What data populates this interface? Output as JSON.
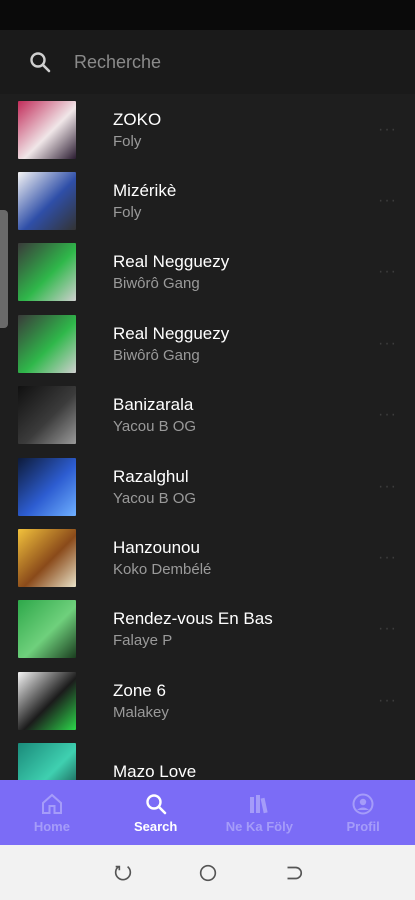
{
  "search": {
    "placeholder": "Recherche",
    "icon": "search-icon"
  },
  "tracks": [
    {
      "title": "ZOKO",
      "artist": "Foly",
      "more": "···",
      "art_colors": [
        "#c22c5a",
        "#f0e6e8",
        "#2a1b30"
      ]
    },
    {
      "title": "Mizérikè",
      "artist": "Foly",
      "more": "···",
      "art_colors": [
        "#f4f4f4",
        "#2f4fa8",
        "#333333"
      ]
    },
    {
      "title": "Real Negguezy",
      "artist": "Biwôrô Gang",
      "more": "···",
      "art_colors": [
        "#3a3a3a",
        "#2fb84a",
        "#cfcfcf"
      ]
    },
    {
      "title": "Real Negguezy",
      "artist": "Biwôrô Gang",
      "more": "···",
      "art_colors": [
        "#3a3a3a",
        "#2fb84a",
        "#cfcfcf"
      ]
    },
    {
      "title": "Banizarala",
      "artist": "Yacou B OG",
      "more": "···",
      "art_colors": [
        "#101010",
        "#3b3b3b",
        "#9a9a9a"
      ]
    },
    {
      "title": "Razalghul",
      "artist": "Yacou B OG",
      "more": "···",
      "art_colors": [
        "#0d1b3a",
        "#2d5dd1",
        "#6fb0ff"
      ]
    },
    {
      "title": "Hanzounou",
      "artist": "Koko Dembélé",
      "more": "···",
      "art_colors": [
        "#f2c23c",
        "#8a4a1a",
        "#e9e2c8"
      ]
    },
    {
      "title": "Rendez-vous En Bas",
      "artist": "Falaye P",
      "more": "···",
      "art_colors": [
        "#2ea84a",
        "#6fd07c",
        "#1a3d1f"
      ]
    },
    {
      "title": "Zone 6",
      "artist": "Malakey",
      "more": "···",
      "art_colors": [
        "#f5f5f5",
        "#1b1b1b",
        "#2cd84a"
      ]
    },
    {
      "title": "Mazo Love",
      "artist": "",
      "more": "",
      "art_colors": [
        "#1a8a7a",
        "#3fd0b0",
        "#0d3d3a"
      ]
    }
  ],
  "nav": {
    "items": [
      {
        "label": "Home",
        "icon": "home-icon",
        "active": false
      },
      {
        "label": "Search",
        "icon": "search-icon",
        "active": true
      },
      {
        "label": "Ne Ka Föly",
        "icon": "library-icon",
        "active": false
      },
      {
        "label": "Profil",
        "icon": "profile-icon",
        "active": false
      }
    ]
  },
  "system_nav": [
    "recents-icon",
    "home-circle-icon",
    "back-icon"
  ],
  "colors": {
    "accent": "#7b6cf6",
    "background": "#1e1e1e",
    "nav_inactive": "#a59cf9"
  }
}
